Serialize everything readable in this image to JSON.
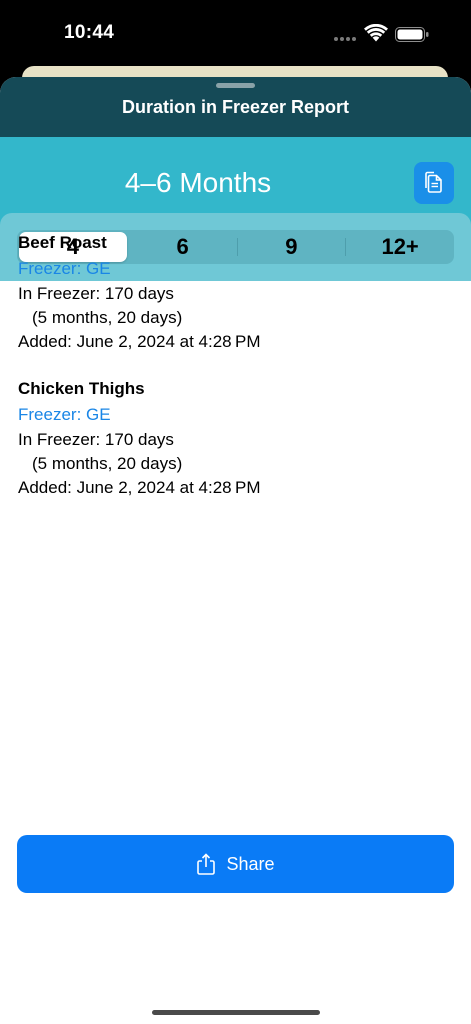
{
  "status_bar": {
    "time": "10:44"
  },
  "sheet": {
    "title": "Duration in Freezer Report"
  },
  "range": {
    "title": "4–6 Months"
  },
  "segments": {
    "items": [
      "4",
      "6",
      "9",
      "12+"
    ],
    "selected": "4"
  },
  "items": [
    {
      "name": "Beef Roast",
      "freezer": "Freezer: GE",
      "in_freezer": "In Freezer: 170 days",
      "breakdown": "(5 months, 20 days)",
      "added": "Added: June 2, 2024 at 4:28 PM"
    },
    {
      "name": "Chicken Thighs",
      "freezer": "Freezer: GE",
      "in_freezer": "In Freezer: 170 days",
      "breakdown": "(5 months, 20 days)",
      "added": "Added: June 2, 2024 at 4:28 PM"
    }
  ],
  "share": {
    "label": "Share"
  },
  "colors": {
    "header": "#154a57",
    "band": "#33b7cb",
    "accent_blue": "#0a7bf6",
    "link_blue": "#1a86e6"
  },
  "icons": {
    "copy": "copy-icon",
    "share": "share-icon",
    "wifi": "wifi-icon",
    "battery": "battery-icon"
  }
}
